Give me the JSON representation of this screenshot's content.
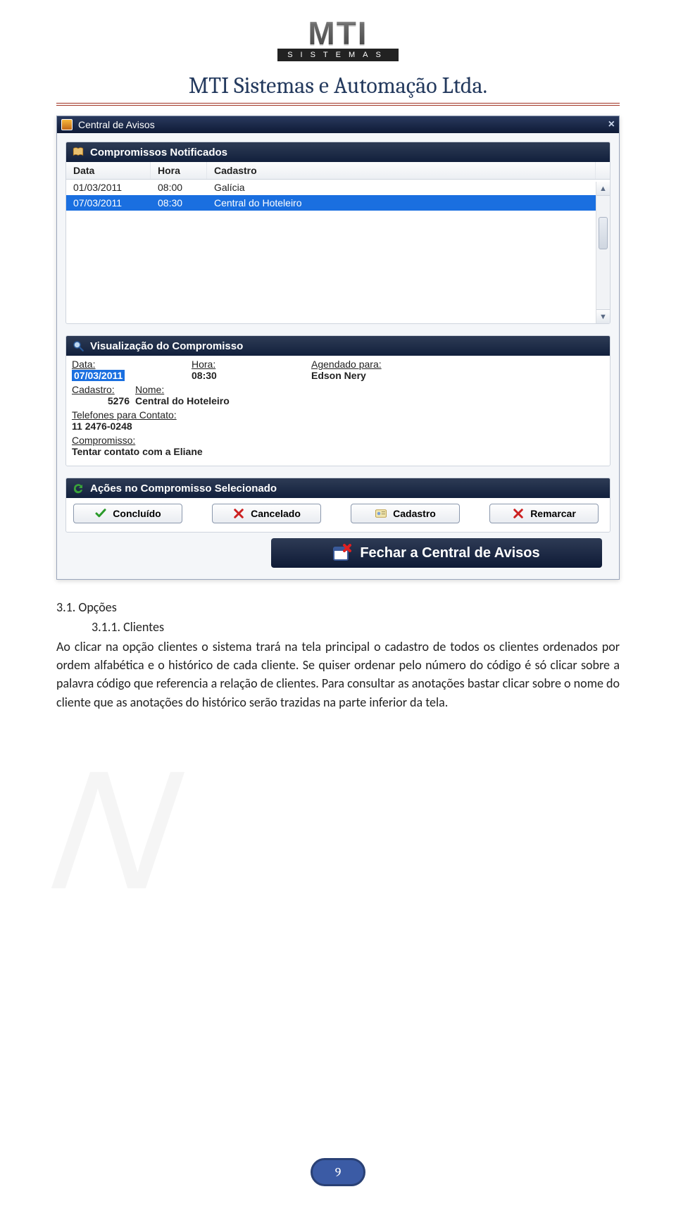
{
  "header": {
    "logo_main": "MTI",
    "logo_sub": "SISTEMAS",
    "doc_title": "MTI Sistemas e Automação Ltda."
  },
  "dialog": {
    "title": "Central de Avisos",
    "close_x": "×"
  },
  "panel_notif": {
    "title": "Compromissos Notificados",
    "columns": {
      "data": "Data",
      "hora": "Hora",
      "cadastro": "Cadastro"
    },
    "rows": [
      {
        "data": "01/03/2011",
        "hora": "08:00",
        "cadastro": "Galícia",
        "selected": false
      },
      {
        "data": "07/03/2011",
        "hora": "08:30",
        "cadastro": "Central do Hoteleiro",
        "selected": true
      }
    ]
  },
  "panel_view": {
    "title": "Visualização do Compromisso",
    "labels": {
      "data": "Data:",
      "hora": "Hora:",
      "agendado": "Agendado para:",
      "cadastro": "Cadastro:",
      "nome": "Nome:",
      "telefones": "Telefones para Contato:",
      "compromisso": "Compromisso:"
    },
    "values": {
      "data": "07/03/2011",
      "hora": "08:30",
      "agendado": "Edson Nery",
      "cadastro": "5276",
      "nome": "Central do Hoteleiro",
      "telefones": "11  2476-0248",
      "compromisso": "Tentar contato com a Eliane"
    }
  },
  "panel_actions": {
    "title": "Ações no Compromisso Selecionado",
    "buttons": {
      "concluido": "Concluído",
      "cancelado": "Cancelado",
      "cadastro": "Cadastro",
      "remarcar": "Remarcar"
    }
  },
  "close_bar": {
    "label": "Fechar a Central de Avisos"
  },
  "body": {
    "sec_num": "3.1. Opções",
    "subsec_num": "3.1.1. Clientes",
    "paragraph": "Ao clicar na opção clientes o sistema trará na tela principal o cadastro de todos os clientes ordenados por ordem alfabética e o histórico de cada cliente. Se quiser ordenar pelo número do código é só clicar sobre a palavra código que referencia a relação de clientes. Para consultar as anotações bastar clicar sobre o nome do cliente que as anotações do histórico serão trazidas na parte inferior da tela."
  },
  "page_number": "9"
}
